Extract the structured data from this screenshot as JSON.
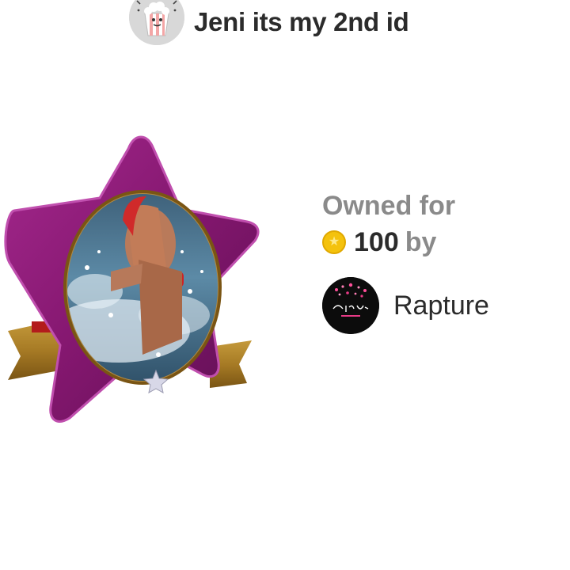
{
  "header": {
    "username": "Jeni its my 2nd id",
    "avatar_icon": "popcorn-mascot-icon"
  },
  "frame": {
    "shape": "star-frame",
    "frame_color": "#8e1a78",
    "ribbon_color": "#a77b25",
    "photo_subject": "person splashing in sea water"
  },
  "ownership": {
    "label": "Owned for",
    "price": "100",
    "by_label": "by",
    "coin_icon": "coin-icon",
    "coin_color": "#f4c20d",
    "owner": {
      "name": "Rapture",
      "avatar_text": "Happy Love"
    }
  }
}
